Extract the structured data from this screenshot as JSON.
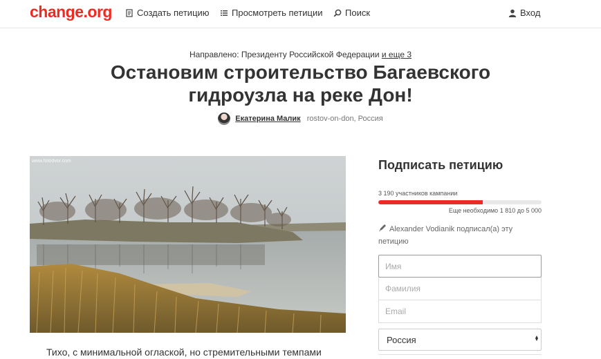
{
  "header": {
    "logo": "change.org",
    "nav": {
      "create": "Создать петицию",
      "browse": "Просмотреть петиции",
      "search": "Поиск",
      "login": "Вход"
    },
    "icons": {
      "create": "petition-document-icon",
      "browse": "list-icon",
      "search": "search-icon",
      "login": "user-icon"
    }
  },
  "petition": {
    "directed_prefix": "Направлено: Президенту Российской Федерации ",
    "directed_more": "и еще 3",
    "title": "Остановим строительство Багаевского гидроузла на реке Дон!",
    "author_name": "Екатерина Малик",
    "author_location": "rostov-on-don, Россия",
    "photo_watermark": "www.fotodvor.com",
    "body_start": "Тихо, с минимальной оглаской, но стремительными темпами"
  },
  "sign": {
    "title": "Подписать петицию",
    "supporters": "3 190 участников кампании",
    "progress_fraction": 0.64,
    "needed": "Еще необходимо 1 810 до 5 000",
    "recent_signer": "Alexander Vodianik подписал(а) эту петицию",
    "first_name_placeholder": "Имя",
    "last_name_placeholder": "Фамилия",
    "email_placeholder": "Email",
    "country": "Россия"
  },
  "colors": {
    "brand": "#ec2c22",
    "text": "#333333"
  }
}
